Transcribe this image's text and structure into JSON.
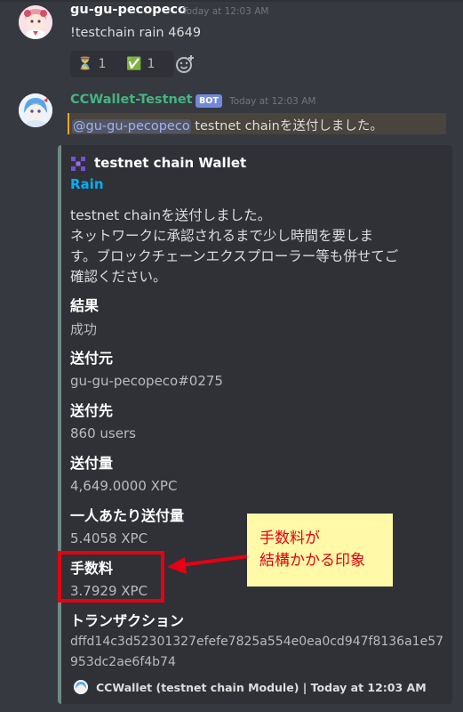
{
  "message1": {
    "username": "gu-gu-pecopeco",
    "timestamp": "Today at 12:03 AM",
    "text": "!testchain rain 4649",
    "reactions": [
      {
        "emoji": "⏳",
        "count": "1"
      },
      {
        "emoji": "✅",
        "count": "1"
      }
    ]
  },
  "message2": {
    "username": "CCWallet-Testnet",
    "badge": "BOT",
    "timestamp": "Today at 12:03 AM",
    "mention": "@gu-gu-pecopeco",
    "text": " testnet chainを送付しました。"
  },
  "embed": {
    "border_color": "#6e8a84",
    "title": "testnet chain Wallet",
    "subtitle": "Rain",
    "description_lines": [
      "testnet chainを送付しました。",
      "ネットワークに承認されるまで少し時間を要しま",
      "す。ブロックチェーンエクスプローラー等も併せてご",
      "確認ください。"
    ],
    "fields": [
      {
        "name": "結果",
        "value": "成功"
      },
      {
        "name": "送付元",
        "value": "gu-gu-pecopeco#0275"
      },
      {
        "name": "送付先",
        "value": "860 users"
      },
      {
        "name": "送付量",
        "value": "4,649.0000 XPC"
      },
      {
        "name": "一人あたり送付量",
        "value": "5.4058 XPC"
      },
      {
        "name": "手数料",
        "value": "3.7929 XPC"
      },
      {
        "name": "トランザクション",
        "value": "dffd14c3d52301327efefe7825a554e0ea0cd947f8136a1e57953dc2ae6f4b74"
      }
    ],
    "footer": "CCWallet (testnet chain Module) | Today at 12:03 AM"
  },
  "annotation": {
    "line1": "手数料が",
    "line2": "結構かかる印象",
    "color": "#e60012",
    "background": "#fff9a8"
  }
}
